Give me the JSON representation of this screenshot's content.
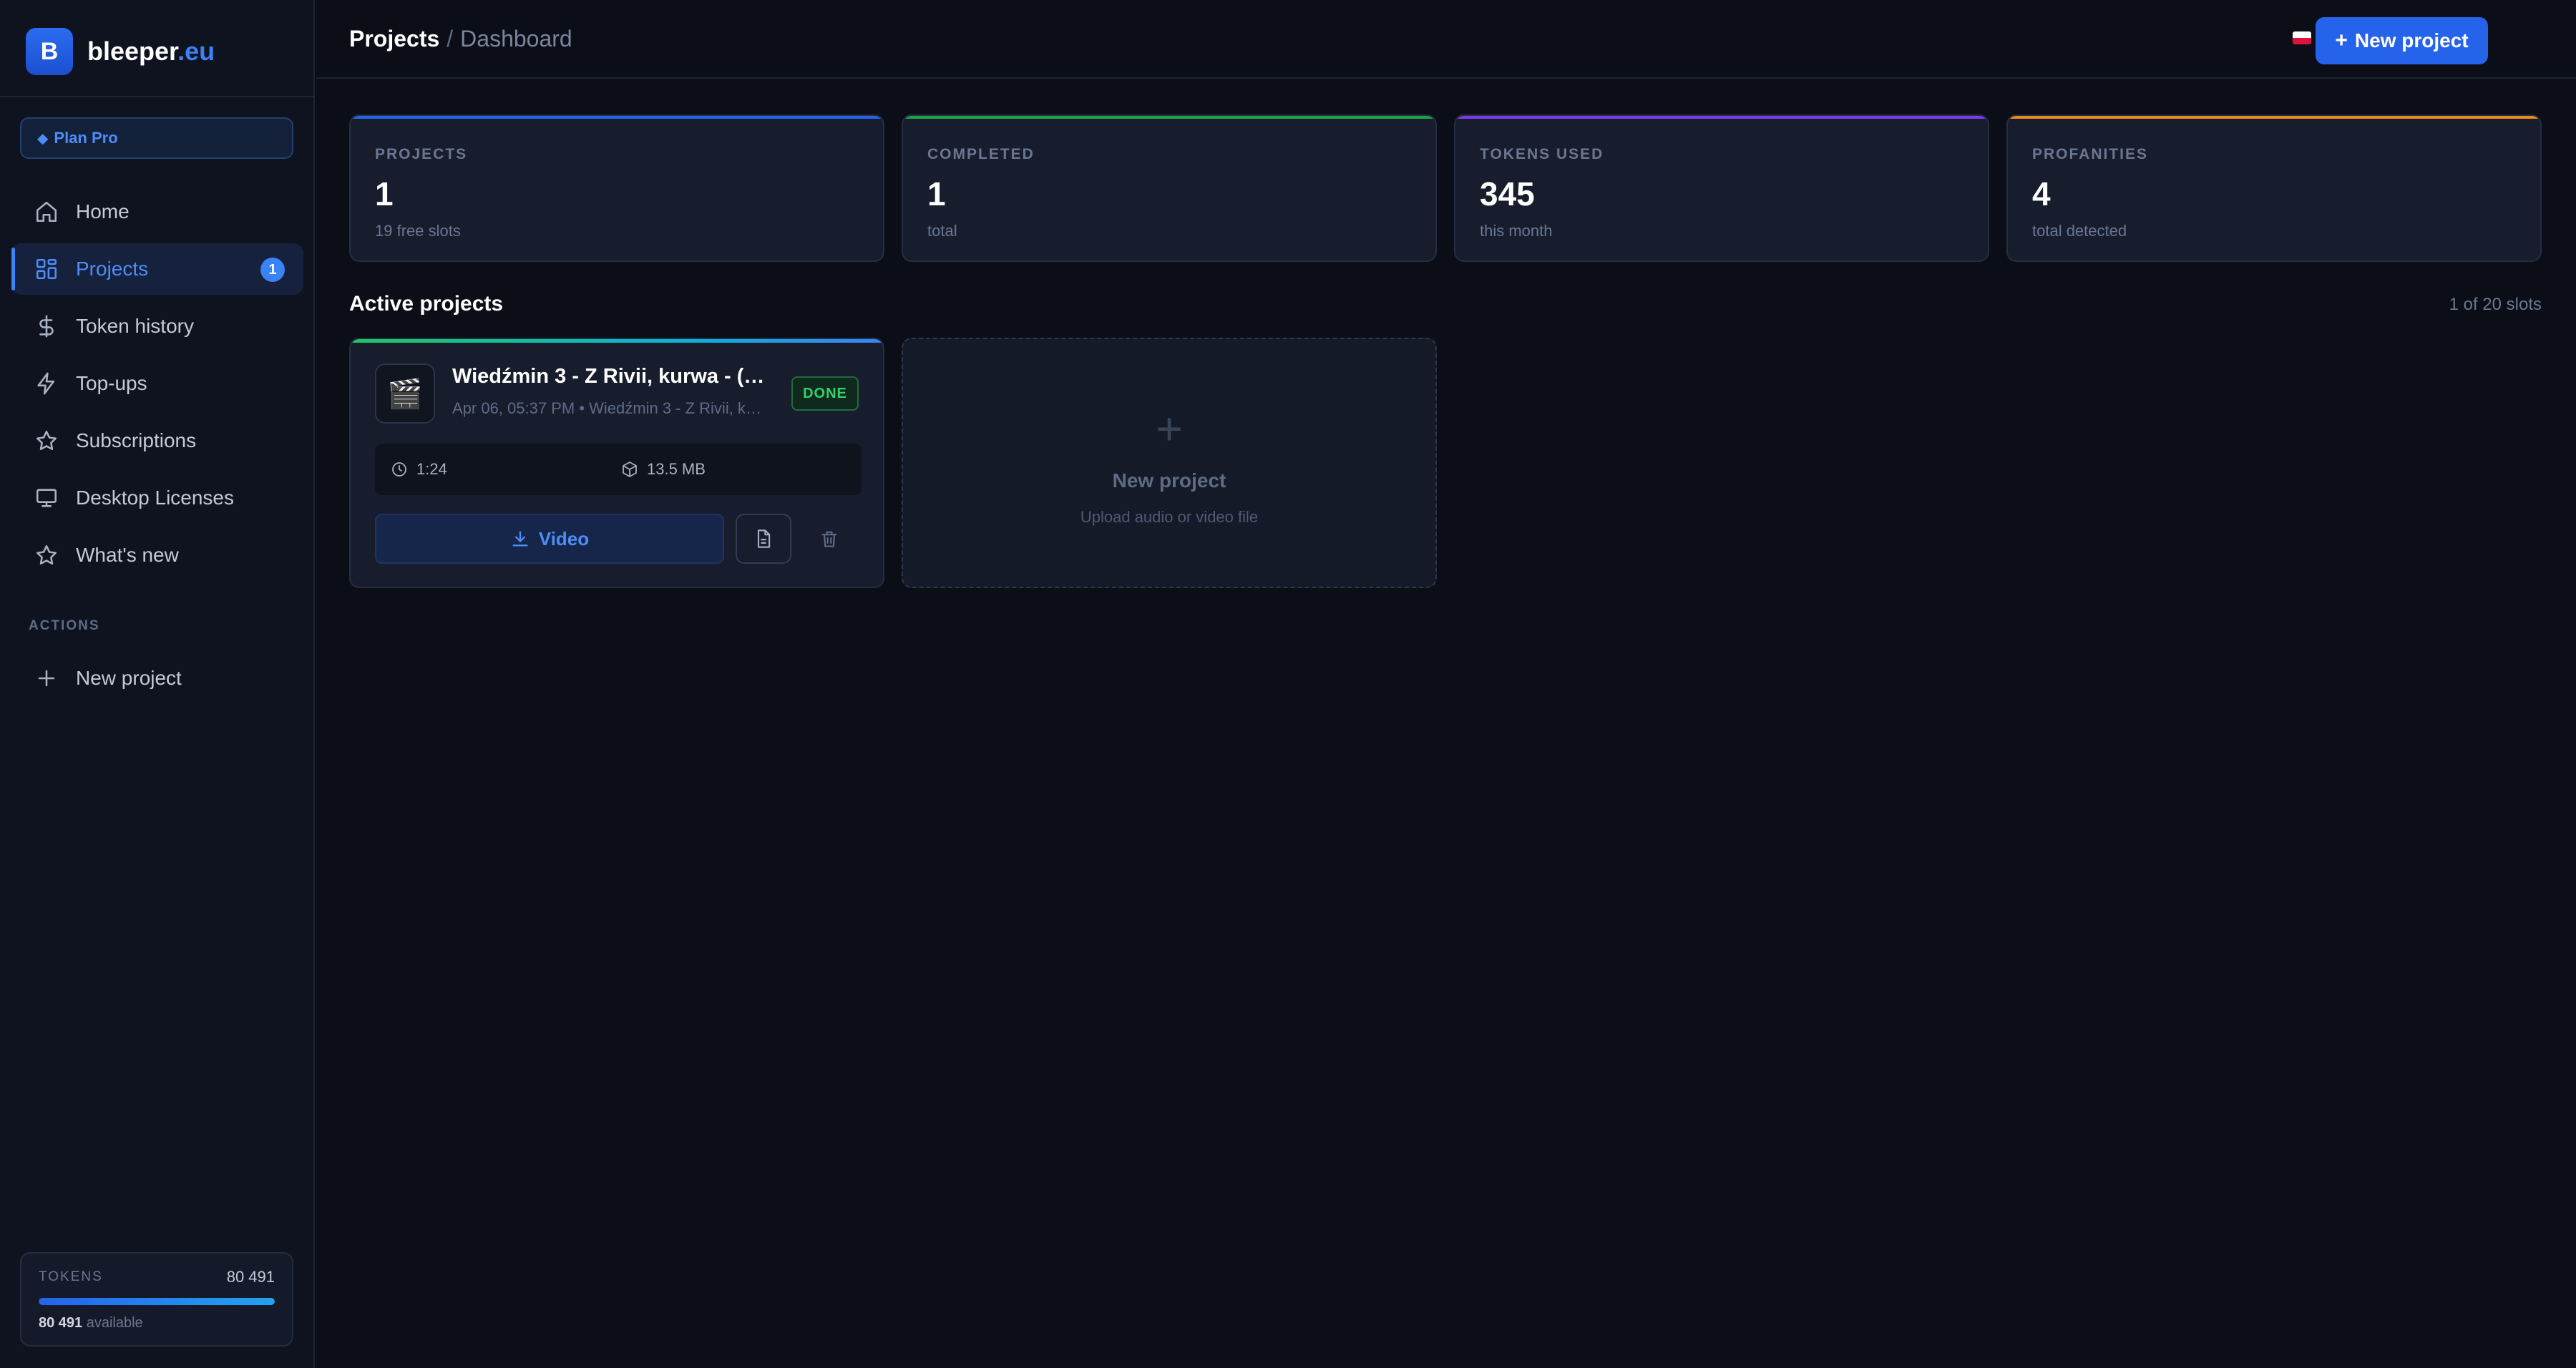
{
  "brand": {
    "logo_letter": "B",
    "name": "bleeper",
    "tld": ".eu"
  },
  "plan": {
    "label": "Plan Pro",
    "icon": "diamond-icon"
  },
  "sidebar": {
    "items": [
      {
        "label": "Home",
        "icon": "home-icon"
      },
      {
        "label": "Projects",
        "icon": "grid-icon",
        "badge": "1",
        "active": true
      },
      {
        "label": "Token history",
        "icon": "dollar-icon"
      },
      {
        "label": "Top-ups",
        "icon": "lightning-icon"
      },
      {
        "label": "Subscriptions",
        "icon": "star-icon"
      },
      {
        "label": "Desktop Licenses",
        "icon": "monitor-icon"
      },
      {
        "label": "What's new",
        "icon": "star-icon"
      }
    ],
    "actions_title": "ACTIONS",
    "actions": [
      {
        "label": "New project",
        "icon": "plus-icon"
      }
    ],
    "tokens": {
      "label": "TOKENS",
      "value": "80 491",
      "available_value": "80 491",
      "available_suffix": "available",
      "fill_fraction": 1.0
    }
  },
  "header": {
    "breadcrumb_main": "Projects",
    "breadcrumb_sep": "/",
    "breadcrumb_sub": "Dashboard",
    "new_project_label": "New project"
  },
  "stats": [
    {
      "label": "PROJECTS",
      "value": "1",
      "sub": "19 free slots",
      "accent": "#2563eb"
    },
    {
      "label": "COMPLETED",
      "value": "1",
      "sub": "total",
      "accent": "#16a34a"
    },
    {
      "label": "TOKENS USED",
      "value": "345",
      "sub": "this month",
      "accent": "#7c3aed"
    },
    {
      "label": "PROFANITIES",
      "value": "4",
      "sub": "total detected",
      "accent": "#ea8a1a"
    }
  ],
  "active": {
    "title": "Active projects",
    "slots": "1 of 20 slots",
    "project": {
      "title": "Wiedźmin 3 - Z Rivii, kurwa - (7...",
      "meta": "Apr 06, 05:37 PM • Wiedźmin 3 - Z Rivii, kur...",
      "status": "DONE",
      "duration": "1:24",
      "size": "13.5 MB",
      "video_label": "Video",
      "thumb_icon": "🎬"
    },
    "new_card": {
      "plus": "+",
      "title": "New project",
      "subtitle": "Upload audio or video file"
    }
  },
  "colors": {
    "accent": "#3b82f6",
    "background": "#0b0e17",
    "success": "#2fd36b"
  }
}
